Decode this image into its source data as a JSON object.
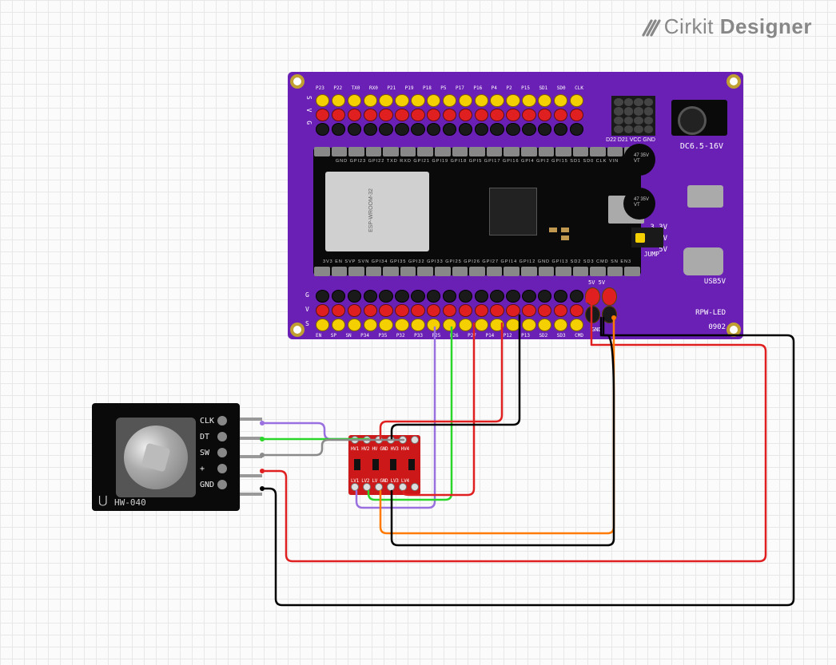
{
  "brand": {
    "prefix": "Cirkit",
    "suffix": " Designer"
  },
  "encoder": {
    "model": "HW-040",
    "pins": [
      "CLK",
      "DT",
      "SW",
      "+",
      "GND"
    ]
  },
  "shifter": {
    "top_labels": [
      "HV1",
      "HV2",
      "HV",
      "GND",
      "HV3",
      "HV4"
    ],
    "bot_labels": [
      "LV1",
      "LV2",
      "LV",
      "GND",
      "LV3",
      "LV4"
    ]
  },
  "board": {
    "model": "ESP32",
    "dc_label": "DC6.5-16V",
    "usb5_label": "USB5V",
    "jump_label": "JUMP",
    "rev_label": "0902",
    "led_label": "RPW-LED",
    "cap_label": "47\n35V\nVT",
    "v33": "3.3V",
    "v5": "5V",
    "v_label": "V",
    "five_v_top": "5V 5V",
    "gnd": "GND",
    "dupont_lbl": "D22 D21 VCC GND",
    "gvs_left_g": "G",
    "gvs_left_v": "V",
    "gvs_left_s": "S",
    "top_pin_letters": "S V G",
    "top_pin_names": "P23 P22 TX0 RX0 P21 P19 P18 P5 P17 P16 P4 P2 P15 SD1 SD0 CLK",
    "bot_pin_names": "EN SP SN P34 P35 P32 P33 P25 P26 P27 P14 P12 P13 SD2 SD3 CMD",
    "dev_top": "GND GPI23 GPI22 TXD RXD GPI21  GPI19 GPI18 GPI5 GPI17 GPI16 GPI4 GPI2 GPI15 SD1 SD0 CLK VIN",
    "dev_bot": "3V3 EN SVP SVN GPI34 GPI35 GPI32 GPI33 GPI25 GPI26 GPI27 GPI14 GPI12 GND GPI13 SD2 SD3 CMD SN EN3",
    "shield": "ESP-WROOM-32"
  },
  "wiring": {
    "encoder_to_shifter": [
      {
        "from": "encoder.CLK",
        "to": "shifter.HV1",
        "color": "#9a6fe0"
      },
      {
        "from": "encoder.DT",
        "to": "shifter.HV2",
        "color": "#2ad62a"
      },
      {
        "from": "encoder.SW",
        "to": "shifter.HV3",
        "color": "#8a8a8a"
      }
    ],
    "encoder_power": [
      {
        "from": "encoder.+",
        "to": "board.5V",
        "color": "#e02020"
      },
      {
        "from": "encoder.GND",
        "to": "board.GND",
        "color": "#000000"
      }
    ],
    "shifter_to_board": [
      {
        "from": "shifter.LV1",
        "to": "board.P26",
        "color": "#9a6fe0"
      },
      {
        "from": "shifter.LV2",
        "to": "board.P27",
        "color": "#2ad62a"
      },
      {
        "from": "shifter.LV3",
        "to": "board.P12",
        "color": "#e02020"
      },
      {
        "from": "shifter.HV",
        "to": "board.5V",
        "color": "#e02020"
      },
      {
        "from": "shifter.LV",
        "to": "board.3.3V",
        "color": "#ff7a00"
      },
      {
        "from": "shifter.GND",
        "to": "board.GND",
        "color": "#000000"
      }
    ]
  }
}
